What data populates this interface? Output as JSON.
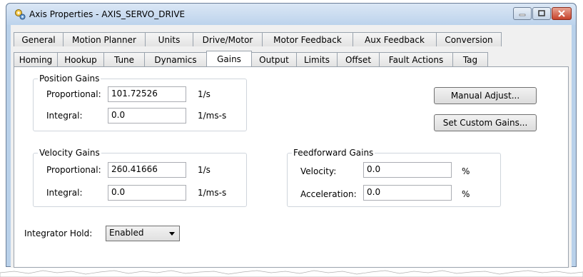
{
  "window": {
    "title": "Axis Properties - AXIS_SERVO_DRIVE",
    "icon": "gear-icon"
  },
  "tabs_row1": [
    "General",
    "Motion Planner",
    "Units",
    "Drive/Motor",
    "Motor Feedback",
    "Aux Feedback",
    "Conversion"
  ],
  "tabs_row2": [
    "Homing",
    "Hookup",
    "Tune",
    "Dynamics",
    "Gains",
    "Output",
    "Limits",
    "Offset",
    "Fault Actions",
    "Tag"
  ],
  "active_tab": "Gains",
  "position_gains": {
    "title": "Position Gains",
    "proportional_label": "Proportional:",
    "proportional_value": "101.72526",
    "proportional_unit": "1/s",
    "integral_label": "Integral:",
    "integral_value": "0.0",
    "integral_unit": "1/ms-s"
  },
  "velocity_gains": {
    "title": "Velocity Gains",
    "proportional_label": "Proportional:",
    "proportional_value": "260.41666",
    "proportional_unit": "1/s",
    "integral_label": "Integral:",
    "integral_value": "0.0",
    "integral_unit": "1/ms-s"
  },
  "feedforward_gains": {
    "title": "Feedforward Gains",
    "velocity_label": "Velocity:",
    "velocity_value": "0.0",
    "velocity_unit": "%",
    "acceleration_label": "Acceleration:",
    "acceleration_value": "0.0",
    "acceleration_unit": "%"
  },
  "buttons": {
    "manual_adjust": "Manual Adjust...",
    "set_custom_gains": "Set Custom Gains..."
  },
  "integrator_hold": {
    "label": "Integrator Hold:",
    "value": "Enabled"
  },
  "colors": {
    "titlebar": "#bcd3ec",
    "close_button": "#c7432b",
    "panel": "#ffffff"
  }
}
